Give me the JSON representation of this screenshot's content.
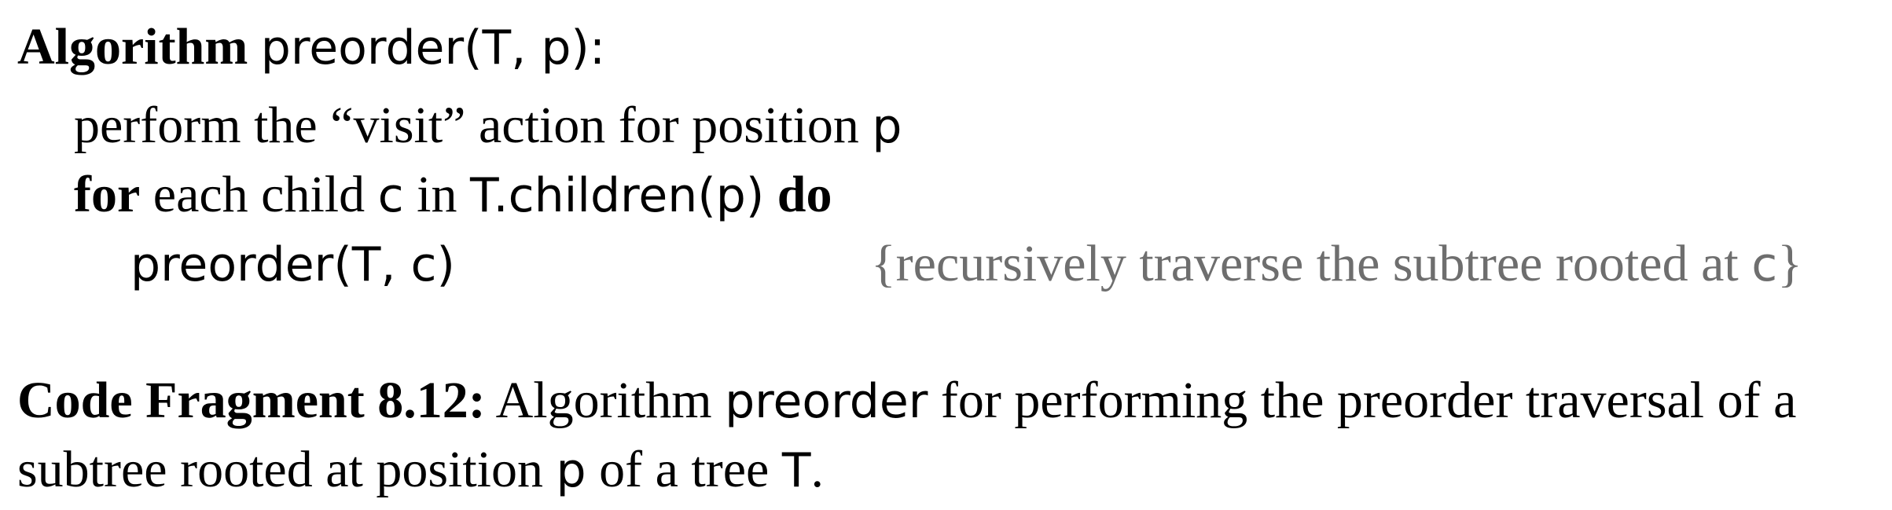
{
  "algorithm": {
    "keyword": "Algorithm",
    "signature": "preorder(T, p):",
    "lines": {
      "visit_text": "perform the “visit” action for position",
      "visit_var": "p",
      "for_kw": "for",
      "for_mid": "each child",
      "for_var": "c",
      "for_in": "in",
      "for_expr": "T.children(p)",
      "do_kw": "do",
      "call": "preorder(T, c)",
      "comment_text": "{recursively traverse the subtree rooted at",
      "comment_var": "c",
      "comment_close": "}"
    }
  },
  "caption": {
    "label": "Code Fragment 8.12:",
    "text_a": "Algorithm",
    "algo_name": "preorder",
    "text_b": "for performing the preorder traversal of a",
    "text_c": "subtree rooted at position",
    "var_p": "p",
    "text_d": "of a tree",
    "var_t": "T",
    "end": "."
  }
}
